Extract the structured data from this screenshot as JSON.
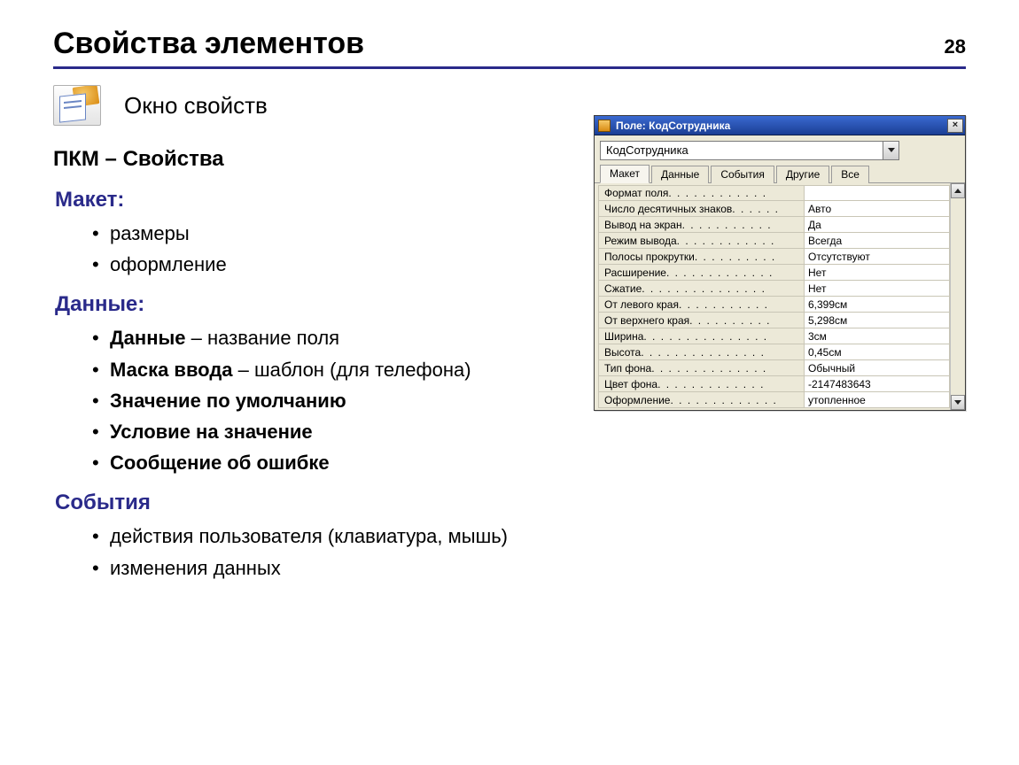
{
  "page": {
    "title": "Свойства элементов",
    "number": "28"
  },
  "icon_label": "Окно свойств",
  "subhead": "ПКМ – Свойства",
  "sections": {
    "layout": {
      "title": "Макет:",
      "items": [
        "размеры",
        "оформление"
      ]
    },
    "data": {
      "title": "Данные:",
      "items": [
        {
          "bold": "Данные",
          "rest": " – название поля"
        },
        {
          "bold": "Маска ввода",
          "rest": " – шаблон (для телефона)"
        },
        {
          "bold": "Значение по умолчанию",
          "rest": ""
        },
        {
          "bold": "Условие на значение",
          "rest": ""
        },
        {
          "bold": "Сообщение об ошибке",
          "rest": ""
        }
      ]
    },
    "events": {
      "title": "События",
      "items": [
        "действия пользователя (клавиатура, мышь)",
        "изменения данных"
      ]
    }
  },
  "window": {
    "title": "Поле: КодСотрудника",
    "combo_value": "КодСотрудника",
    "tabs": [
      "Макет",
      "Данные",
      "События",
      "Другие",
      "Все"
    ],
    "active_tab": 0,
    "rows": [
      {
        "label": "Формат поля",
        "value": ""
      },
      {
        "label": "Число десятичных знаков",
        "value": "Авто"
      },
      {
        "label": "Вывод на экран",
        "value": "Да"
      },
      {
        "label": "Режим вывода",
        "value": "Всегда"
      },
      {
        "label": "Полосы прокрутки",
        "value": "Отсутствуют"
      },
      {
        "label": "Расширение",
        "value": "Нет"
      },
      {
        "label": "Сжатие",
        "value": "Нет"
      },
      {
        "label": "От левого края",
        "value": "6,399см"
      },
      {
        "label": "От верхнего края",
        "value": "5,298см"
      },
      {
        "label": "Ширина",
        "value": "3см"
      },
      {
        "label": "Высота",
        "value": "0,45см"
      },
      {
        "label": "Тип фона",
        "value": "Обычный"
      },
      {
        "label": "Цвет фона",
        "value": "-2147483643"
      },
      {
        "label": "Оформление",
        "value": "утопленное"
      }
    ]
  }
}
